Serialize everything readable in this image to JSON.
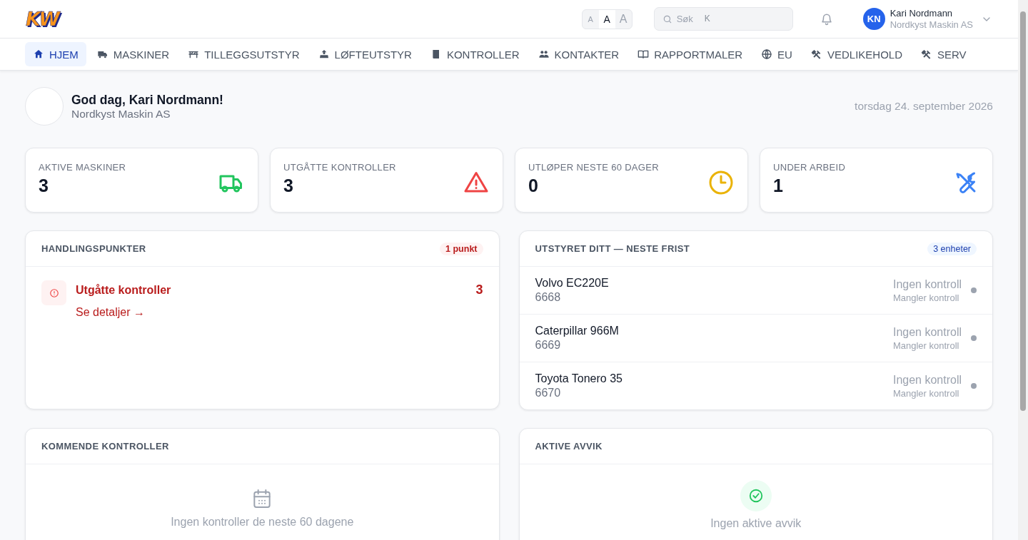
{
  "logo": "KW",
  "font_sizes": [
    {
      "label": "A",
      "selected": false
    },
    {
      "label": "A",
      "selected": true
    },
    {
      "label": "A",
      "selected": false
    }
  ],
  "search": {
    "placeholder": "Søk",
    "shortcut": "K"
  },
  "user": {
    "initials": "KN",
    "name": "Kari Nordmann",
    "company": "Nordkyst Maskin AS"
  },
  "nav": [
    {
      "label": "HJEM",
      "selected": true
    },
    {
      "label": "MASKINER",
      "selected": false
    },
    {
      "label": "TILLEGGSUTSTYR",
      "selected": false
    },
    {
      "label": "LØFTEUTSTYR",
      "selected": false
    },
    {
      "label": "KONTROLLER",
      "selected": false
    },
    {
      "label": "KONTAKTER",
      "selected": false
    },
    {
      "label": "RAPPORTMALER",
      "selected": false
    },
    {
      "label": "EU",
      "selected": false
    },
    {
      "label": "VEDLIKEHOLD",
      "selected": false
    },
    {
      "label": "SERV",
      "selected": false
    }
  ],
  "greeting": {
    "title": "God dag, Kari Nordmann!",
    "company": "Nordkyst Maskin AS",
    "date": "torsdag 24. september 2026"
  },
  "stats": [
    {
      "label": "AKTIVE MASKINER",
      "value": "3"
    },
    {
      "label": "UTGÅTTE KONTROLLER",
      "value": "3"
    },
    {
      "label": "UTLØPER NESTE 60 DAGER",
      "value": "0"
    },
    {
      "label": "UNDER ARBEID",
      "value": "1"
    }
  ],
  "action_points": {
    "title": "HANDLINGSPUNKTER",
    "badge": "1 punkt",
    "items": [
      {
        "title": "Utgåtte kontroller",
        "count": "3",
        "link": "Se detaljer →"
      }
    ]
  },
  "equipment": {
    "title": "UTSTYRET DITT — NESTE FRIST",
    "badge": "3 enheter",
    "rows": [
      {
        "name": "Volvo EC220E",
        "number": "6668",
        "status": "Ingen kontroll",
        "detail": "Mangler kontroll",
        "color": "#9ca3af"
      },
      {
        "name": "Caterpillar 966M",
        "number": "6669",
        "status": "Ingen kontroll",
        "detail": "Mangler kontroll",
        "color": "#9ca3af"
      },
      {
        "name": "Toyota Tonero 35",
        "number": "6670",
        "status": "Ingen kontroll",
        "detail": "Mangler kontroll",
        "color": "#9ca3af"
      }
    ]
  },
  "upcoming": {
    "title": "KOMMENDE KONTROLLER",
    "empty": "Ingen kontroller de neste 60 dagene"
  },
  "deviations": {
    "title": "AKTIVE AVVIK",
    "empty": "Ingen aktive avvik"
  }
}
